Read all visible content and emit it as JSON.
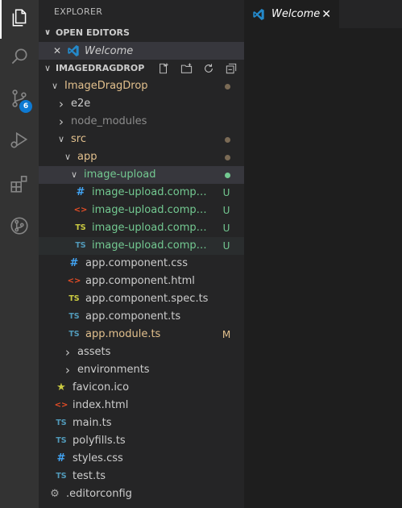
{
  "activity_bar": {
    "items": [
      {
        "name": "explorer",
        "icon": "files-icon"
      },
      {
        "name": "search",
        "icon": "search-icon"
      },
      {
        "name": "source-control",
        "icon": "source-control-icon",
        "badge": "6"
      },
      {
        "name": "run-debug",
        "icon": "run-debug-icon"
      },
      {
        "name": "extensions",
        "icon": "extensions-icon"
      },
      {
        "name": "git-graph",
        "icon": "git-graph-icon"
      }
    ]
  },
  "sidebar": {
    "title": "EXPLORER",
    "open_editors": {
      "header": "OPEN EDITORS",
      "items": [
        {
          "label": "Welcome",
          "close": "✕"
        }
      ]
    },
    "workspace": {
      "header": "IMAGEDRAGDROP",
      "tree": [
        {
          "label": "ImageDragDrop",
          "type": "folder",
          "open": true,
          "depth": 1,
          "color": "modified",
          "dot": true
        },
        {
          "label": "e2e",
          "type": "folder",
          "open": false,
          "depth": 2,
          "color": "normal"
        },
        {
          "label": "node_modules",
          "type": "folder",
          "open": false,
          "depth": 2,
          "color": "ignored"
        },
        {
          "label": "src",
          "type": "folder",
          "open": true,
          "depth": 2,
          "color": "modified",
          "dot": true
        },
        {
          "label": "app",
          "type": "folder",
          "open": true,
          "depth": 3,
          "color": "modified",
          "dot": true
        },
        {
          "label": "image-upload",
          "type": "folder",
          "open": true,
          "depth": 4,
          "color": "untracked",
          "dot": true,
          "selected": true
        },
        {
          "label": "image-upload.component.css",
          "type": "css",
          "depth": 5,
          "color": "untracked",
          "status": "U"
        },
        {
          "label": "image-upload.component.html",
          "type": "html",
          "depth": 5,
          "color": "untracked",
          "status": "U"
        },
        {
          "label": "image-upload.component.spec.ts",
          "type": "spec",
          "depth": 5,
          "color": "untracked",
          "status": "U"
        },
        {
          "label": "image-upload.component.ts",
          "type": "ts",
          "depth": 5,
          "color": "untracked",
          "status": "U",
          "hover": true
        },
        {
          "label": "app.component.css",
          "type": "css",
          "depth": 4,
          "color": "normal"
        },
        {
          "label": "app.component.html",
          "type": "html",
          "depth": 4,
          "color": "normal"
        },
        {
          "label": "app.component.spec.ts",
          "type": "spec",
          "depth": 4,
          "color": "normal"
        },
        {
          "label": "app.component.ts",
          "type": "ts",
          "depth": 4,
          "color": "normal"
        },
        {
          "label": "app.module.ts",
          "type": "ts",
          "depth": 4,
          "color": "modified",
          "status": "M"
        },
        {
          "label": "assets",
          "type": "folder",
          "open": false,
          "depth": 3,
          "color": "normal"
        },
        {
          "label": "environments",
          "type": "folder",
          "open": false,
          "depth": 3,
          "color": "normal"
        },
        {
          "label": "favicon.ico",
          "type": "favicon",
          "depth": 2,
          "color": "normal"
        },
        {
          "label": "index.html",
          "type": "html",
          "depth": 2,
          "color": "normal"
        },
        {
          "label": "main.ts",
          "type": "ts",
          "depth": 2,
          "color": "normal"
        },
        {
          "label": "polyfills.ts",
          "type": "ts",
          "depth": 2,
          "color": "normal"
        },
        {
          "label": "styles.css",
          "type": "css",
          "depth": 2,
          "color": "normal"
        },
        {
          "label": "test.ts",
          "type": "ts",
          "depth": 2,
          "color": "normal"
        },
        {
          "label": ".editorconfig",
          "type": "config",
          "depth": 1,
          "color": "normal"
        }
      ]
    }
  },
  "editor": {
    "tabs": [
      {
        "label": "Welcome",
        "close": "✕",
        "active": true
      }
    ]
  },
  "colors": {
    "untracked": "#73c991",
    "modified": "#e2c08d",
    "ignored": "#8c8c8c",
    "accent": "#0e7ad3",
    "vscode_blue": "#2489ca",
    "css_icon": "#42a5f5",
    "html_icon": "#e44d26",
    "spec_icon": "#cbcb41",
    "ts_icon": "#519aba"
  }
}
